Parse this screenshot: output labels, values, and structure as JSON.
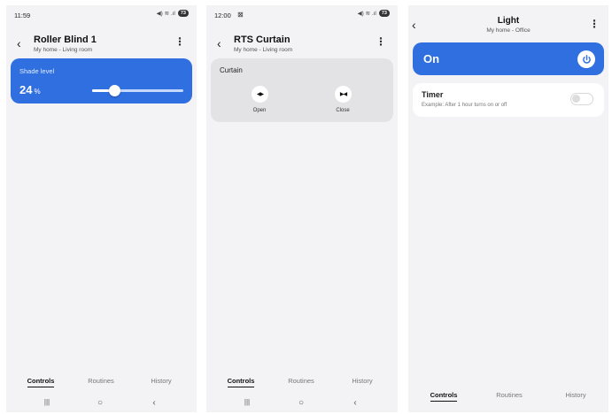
{
  "screen1": {
    "status": {
      "time": "11:59",
      "icons": "◀) ≋ .ıl",
      "battery": "73"
    },
    "header": {
      "back": "‹",
      "title": "Roller Blind 1",
      "subtitle": "My home - Living room",
      "more": "⋮"
    },
    "shade": {
      "label": "Shade level",
      "value": "24",
      "unit": "%",
      "level_percent": 24
    },
    "tabs": [
      "Controls",
      "Routines",
      "History"
    ],
    "nav": [
      "|||",
      "○",
      "‹"
    ]
  },
  "screen2": {
    "status": {
      "time": "12:00",
      "extra": "⊠",
      "icons": "◀) ≋ .ıl",
      "battery": "73"
    },
    "header": {
      "back": "‹",
      "title": "RTS Curtain",
      "subtitle": "My home - Living room",
      "more": "⋮"
    },
    "curtain": {
      "label": "Curtain",
      "open_icon": "◀▶",
      "open_label": "Open",
      "close_icon": "▶◀",
      "close_label": "Close"
    },
    "tabs": [
      "Controls",
      "Routines",
      "History"
    ],
    "nav": [
      "|||",
      "○",
      "‹"
    ]
  },
  "screen3": {
    "header": {
      "back": "‹",
      "title": "Light",
      "subtitle": "My home - Office",
      "more": "⋮"
    },
    "power": {
      "label": "On"
    },
    "timer": {
      "label": "Timer",
      "desc": "Example: After 1 hour turns on or off"
    },
    "tabs": [
      "Controls",
      "Routines",
      "History"
    ]
  },
  "colors": {
    "accent": "#2f6fe0",
    "background": "#f3f3f5"
  }
}
